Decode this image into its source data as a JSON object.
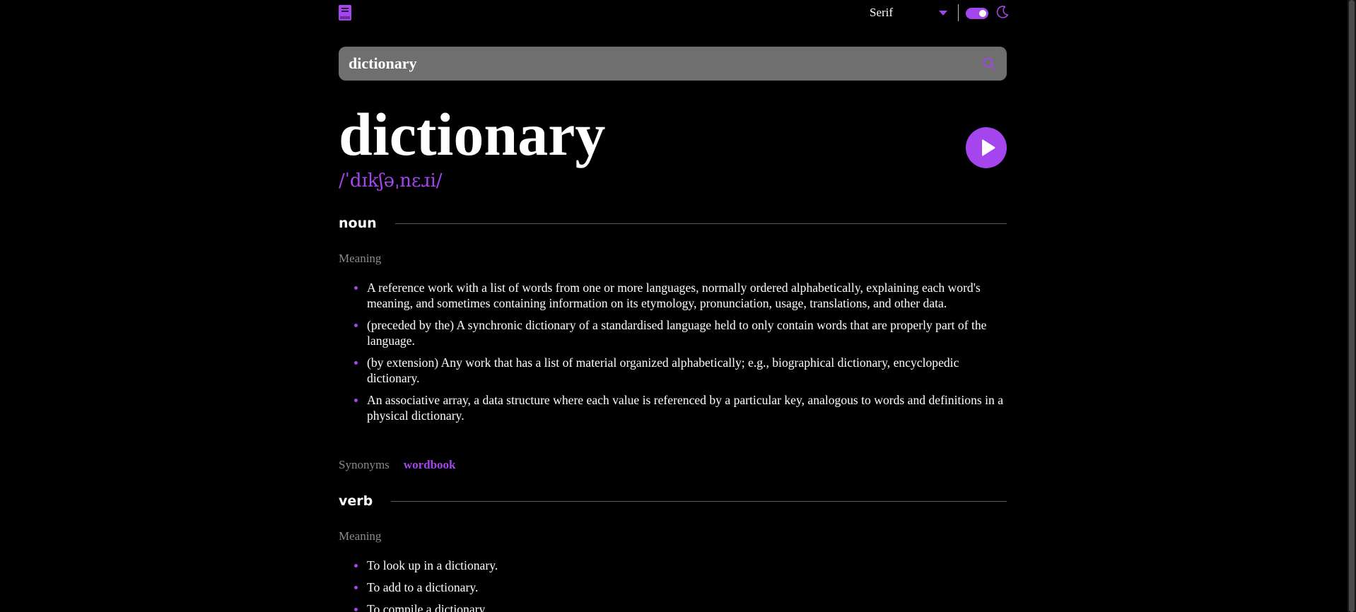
{
  "header": {
    "logo_icon": "book-icon",
    "font_select": {
      "selected": "Serif"
    },
    "theme_toggle": {
      "state": "dark"
    },
    "theme_icon": "moon-icon"
  },
  "search": {
    "value": "dictionary",
    "placeholder": "",
    "icon": "search-icon"
  },
  "entry": {
    "word": "dictionary",
    "phonetic": "/ˈdɪkʃəˌnɛɹi/",
    "play_icon": "play-icon"
  },
  "meanings": [
    {
      "part_of_speech": "noun",
      "meaning_label": "Meaning",
      "definitions": [
        "A reference work with a list of words from one or more languages, normally ordered alphabetically, explaining each word's meaning, and sometimes containing information on its etymology, pronunciation, usage, translations, and other data.",
        "(preceded by the) A synchronic dictionary of a standardised language held to only contain words that are properly part of the language.",
        "(by extension) Any work that has a list of material organized alphabetically; e.g., biographical dictionary, encyclopedic dictionary.",
        "An associative array, a data structure where each value is referenced by a particular key, analogous to words and definitions in a physical dictionary."
      ],
      "synonyms_label": "Synonyms",
      "synonyms": [
        "wordbook"
      ]
    },
    {
      "part_of_speech": "verb",
      "meaning_label": "Meaning",
      "definitions": [
        "To look up in a dictionary.",
        "To add to a dictionary.",
        "To compile a dictionary."
      ]
    }
  ],
  "colors": {
    "accent": "#a445ed",
    "background": "#000000",
    "search_bg": "#6f6f6f",
    "muted_text": "#8a8a8a"
  }
}
